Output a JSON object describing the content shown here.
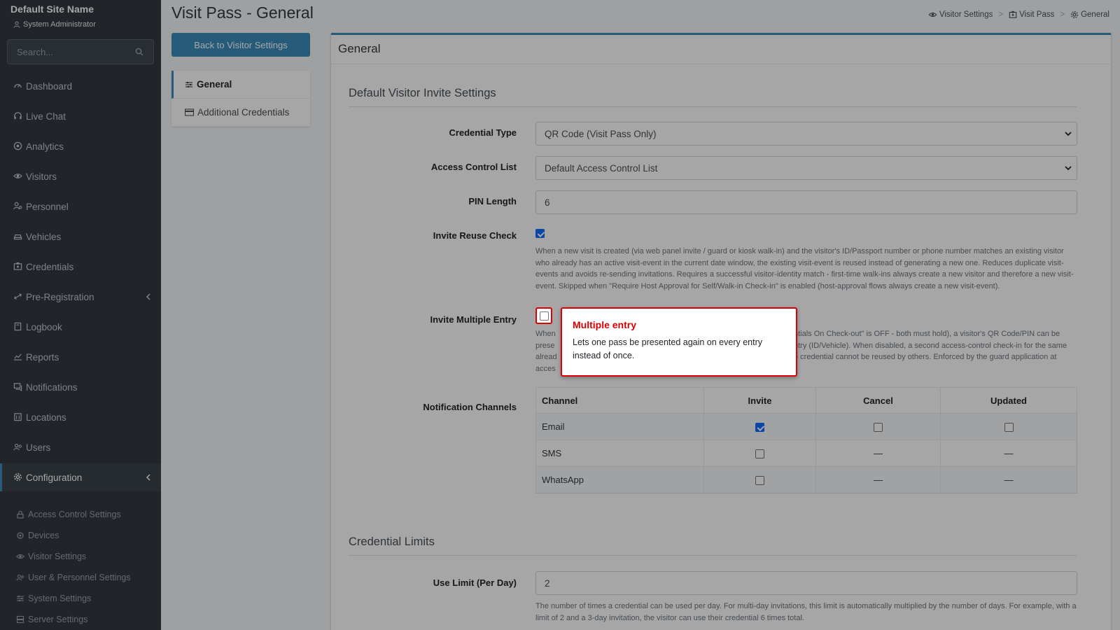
{
  "sidebar": {
    "site_name": "Default Site Name",
    "user_role": "System Administrator",
    "search_placeholder": "Search...",
    "items": [
      {
        "label": "Dashboard",
        "icon": "gauge-icon"
      },
      {
        "label": "Live Chat",
        "icon": "headset-icon"
      },
      {
        "label": "Analytics",
        "icon": "circle-dot-icon"
      },
      {
        "label": "Visitors",
        "icon": "eye-icon"
      },
      {
        "label": "Personnel",
        "icon": "user-gear-icon"
      },
      {
        "label": "Vehicles",
        "icon": "car-icon"
      },
      {
        "label": "Credentials",
        "icon": "id-badge-icon"
      },
      {
        "label": "Pre-Registration",
        "icon": "arrows-icon"
      },
      {
        "label": "Logbook",
        "icon": "book-icon"
      },
      {
        "label": "Reports",
        "icon": "chart-icon"
      },
      {
        "label": "Notifications",
        "icon": "chat-icon"
      },
      {
        "label": "Locations",
        "icon": "building-icon"
      },
      {
        "label": "Users",
        "icon": "users-icon"
      },
      {
        "label": "Configuration",
        "icon": "gear-icon"
      }
    ],
    "sub_items": [
      {
        "label": "Access Control Settings",
        "icon": "lock-icon"
      },
      {
        "label": "Devices",
        "icon": "chip-icon"
      },
      {
        "label": "Visitor Settings",
        "icon": "eye-icon"
      },
      {
        "label": "User & Personnel Settings",
        "icon": "users-icon"
      },
      {
        "label": "System Settings",
        "icon": "sliders-icon"
      },
      {
        "label": "Server Settings",
        "icon": "server-icon"
      }
    ]
  },
  "header": {
    "title": "Visit Pass - General",
    "breadcrumb": [
      "Visitor Settings",
      "Visit Pass",
      "General"
    ]
  },
  "left_menu": {
    "back_label": "Back to Visitor Settings",
    "items": [
      "General",
      "Additional Credentials"
    ]
  },
  "card": {
    "title": "General",
    "section1": "Default Visitor Invite Settings",
    "credential_type": {
      "label": "Credential Type",
      "value": "QR Code (Visit Pass Only)"
    },
    "access_control_list": {
      "label": "Access Control List",
      "value": "Default Access Control List"
    },
    "pin_length": {
      "label": "PIN Length",
      "value": "6"
    },
    "invite_reuse": {
      "label": "Invite Reuse Check",
      "checked": true,
      "help": "When a new visit is created (via web panel invite / guard or kiosk walk-in) and the visitor's ID/Passport number or phone number matches an existing visitor who already has an active visit-event in the current date window, the existing visit-event is reused instead of generating a new one. Reduces duplicate visit-events and avoids re-sending invitations. Requires a successful visitor-identity match - first-time walk-ins always create a new visitor and therefore a new visit-event. Skipped when \"Require Host Approval for Self/Walk-in Check-in\" is enabled (host-approval flows always create a new visit-event)."
    },
    "invite_multiple": {
      "label": "Invite Multiple Entry",
      "checked": false,
      "help_line1_left": "When",
      "help_line1_right": "ntials On Check-out\" is OFF - both must hold), a visitor's QR Code/PIN can be",
      "help_line2_left": "prese",
      "help_line2_right": "ntry (ID/Vehicle). When disabled, a second access-control check-in for the same",
      "help_line3_left": "alread",
      "help_line3_right": "e credential cannot be reused by others. Enforced by the guard application at",
      "help_line4_left": "acces"
    },
    "notification_channels": {
      "label": "Notification Channels",
      "headers": [
        "Channel",
        "Invite",
        "Cancel",
        "Updated"
      ],
      "rows": [
        {
          "channel": "Email",
          "invite": true,
          "cancel": false,
          "updated": false
        },
        {
          "channel": "SMS",
          "invite": false,
          "cancel": "—",
          "updated": "—"
        },
        {
          "channel": "WhatsApp",
          "invite": false,
          "cancel": "—",
          "updated": "—"
        }
      ]
    },
    "section2": "Credential Limits",
    "use_limit": {
      "label": "Use Limit (Per Day)",
      "value": "2",
      "help": "The number of times a credential can be used per day. For multi-day invitations, this limit is automatically multiplied by the number of days. For example, with a limit of 2 and a 3-day invitation, the visitor can use their credential 6 times total."
    }
  },
  "tooltip": {
    "title": "Multiple entry",
    "body": "Lets one pass be presented again on every entry instead of once."
  },
  "colors": {
    "sidebar_bg": "#343a40",
    "accent": "#3c8dbc",
    "highlight": "#dd0000",
    "checkbox": "#0d6efd"
  }
}
